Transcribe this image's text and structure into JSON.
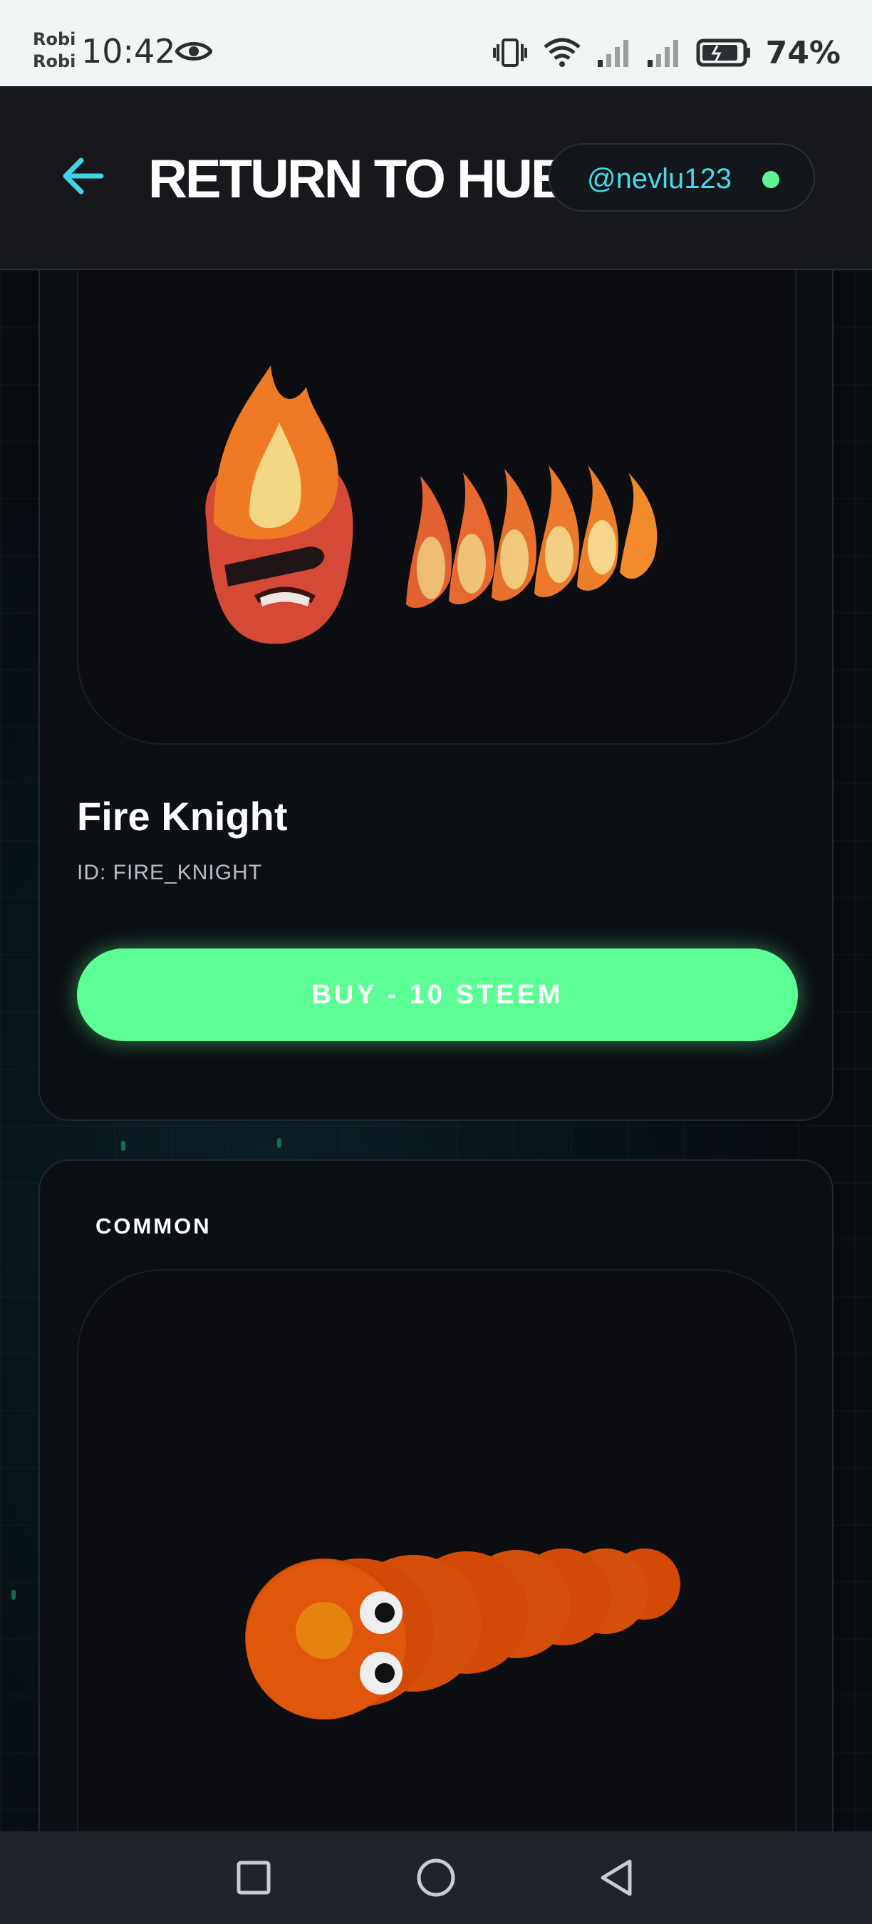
{
  "status_bar": {
    "carrier_line1": "Robi",
    "carrier_line2": "Robi",
    "time": "10:42",
    "battery_percent": "74%",
    "icons": [
      "eye-icon",
      "vibrate-icon",
      "wifi-icon",
      "signal-icon",
      "signal-icon",
      "battery-charging-icon"
    ]
  },
  "header": {
    "back_icon": "arrow-left-icon",
    "title": "RETURN TO HUB",
    "username": "@nevlu123",
    "status_color": "#5ef58f"
  },
  "cards": [
    {
      "name": "Fire Knight",
      "id_text": "ID: FIRE_KNIGHT",
      "button_label": "BUY - 10 STEEM",
      "art": "fire-knight-snake"
    },
    {
      "rarity": "COMMON",
      "art": "orange-snake"
    }
  ],
  "nav_bar": {
    "icons": [
      "recents-square-icon",
      "home-circle-icon",
      "back-triangle-icon"
    ]
  },
  "colors": {
    "accent_green": "#5dfd95",
    "accent_cyan": "#4ad9e8",
    "background": "#070c11"
  }
}
